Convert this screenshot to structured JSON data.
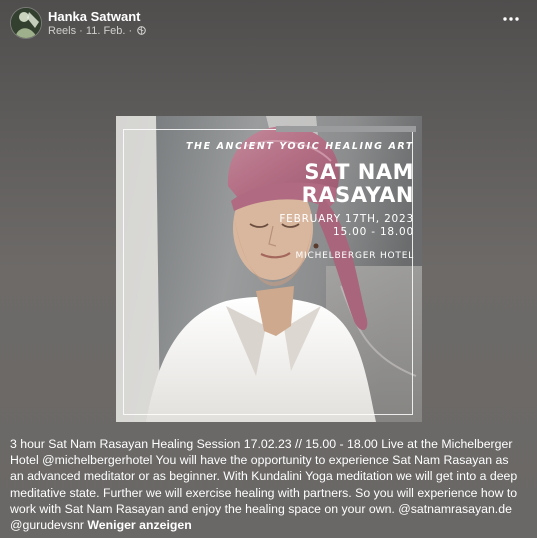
{
  "post": {
    "author": "Hanka Satwant",
    "meta_source": "Reels",
    "meta_separator": " · ",
    "meta_date": "11. Feb.",
    "meta_dot": " · "
  },
  "media": {
    "tagline": "THE ANCIENT YOGIC HEALING ART",
    "title_line1": "SAT NAM",
    "title_line2": "RASAYAN",
    "date": "FEBRUARY 17TH, 2023",
    "time": "15.00 - 18.00",
    "venue": "MICHELBERGER HOTEL"
  },
  "caption": {
    "text": "3 hour Sat Nam Rasayan Healing Session 17.02.23 // 15.00 - 18.00 Live at the Michelberger Hotel @michelbergerhotel You will have the opportunity to experience Sat Nam Rasayan as an advanced meditator or as beginner. With Kundalini Yoga meditation we will get into a deep meditative state. Further we will exercise healing with partners. So you will experience how to work with Sat Nam Rasayan and enjoy the healing space on your own. @satnamrasayan.de @gurudevsnr ",
    "see_less": "Weniger anzeigen"
  },
  "icons": {
    "privacy": "globe-icon",
    "menu": "more-horizontal-icon",
    "avatar": "profile-avatar"
  },
  "colors": {
    "turban": "#b9778c",
    "shirt": "#f2f1ee",
    "skin": "#d8b89e"
  }
}
